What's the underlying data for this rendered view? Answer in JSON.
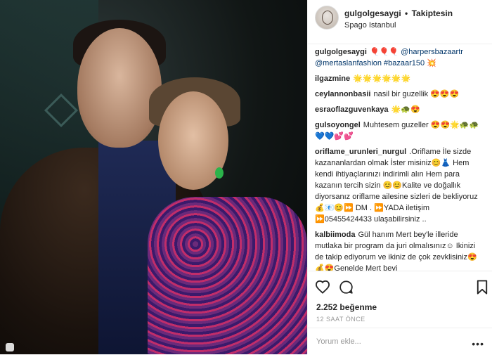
{
  "header": {
    "username": "gulgolgesaygi",
    "separator": "•",
    "follow_status": "Takiptesin",
    "location": "Spago Istanbul"
  },
  "comments": [
    {
      "user": "gulgolgesaygi",
      "text": "🎈🎈🎈 @harpersbazaartr @mertaslanfashion #bazaar150 💥"
    },
    {
      "user": "ilgazmine",
      "text": "🌟🌟🌟🌟🌟🌟"
    },
    {
      "user": "ceylannonbasii",
      "text": "nasil bir guzellik 😍😍😍"
    },
    {
      "user": "esraoflazguvenkaya",
      "text": "🌟🐢😍"
    },
    {
      "user": "gulsoyongel",
      "text": "Muhtesem guzeller 😍😍🌟🐢🐢💙💙💕💕"
    },
    {
      "user": "oriflame_urunleri_nurgul",
      "text": ".Oriflame İle sizde kazananlardan olmak İster misiniz😊👗 Hem kendi ihtiyaçlarınızı indirimli alın Hem para kazanın tercih sizin 😊😊Kalite ve doğallık diyorsanız oriflame ailesine sizleri de bekliyoruz 💰📧😊⏩ DM . ⏩YADA iletişim ⏩05455424433 ulaşabilirsiniz .."
    },
    {
      "user": "kalbiimoda",
      "text": "Gül hanım Mert bey'le illeride mutlaka bir program da juri olmalısınız☺ Ikinizi de takip ediyorum ve ikiniz de çok zevklisiniz😍💰😍Genelde Mert beyi"
    }
  ],
  "actions": {
    "like_icon": "heart-icon",
    "comment_icon": "comment-icon",
    "save_icon": "bookmark-icon"
  },
  "likes_text": "2.252 beğenme",
  "time_text": "12 SAAT ÖNCE",
  "add_comment": {
    "placeholder": "Yorum ekle...",
    "more_label": "•••"
  },
  "colors": {
    "accent_link": "#003569",
    "text": "#262626",
    "muted": "#999999",
    "border": "#efefef"
  }
}
